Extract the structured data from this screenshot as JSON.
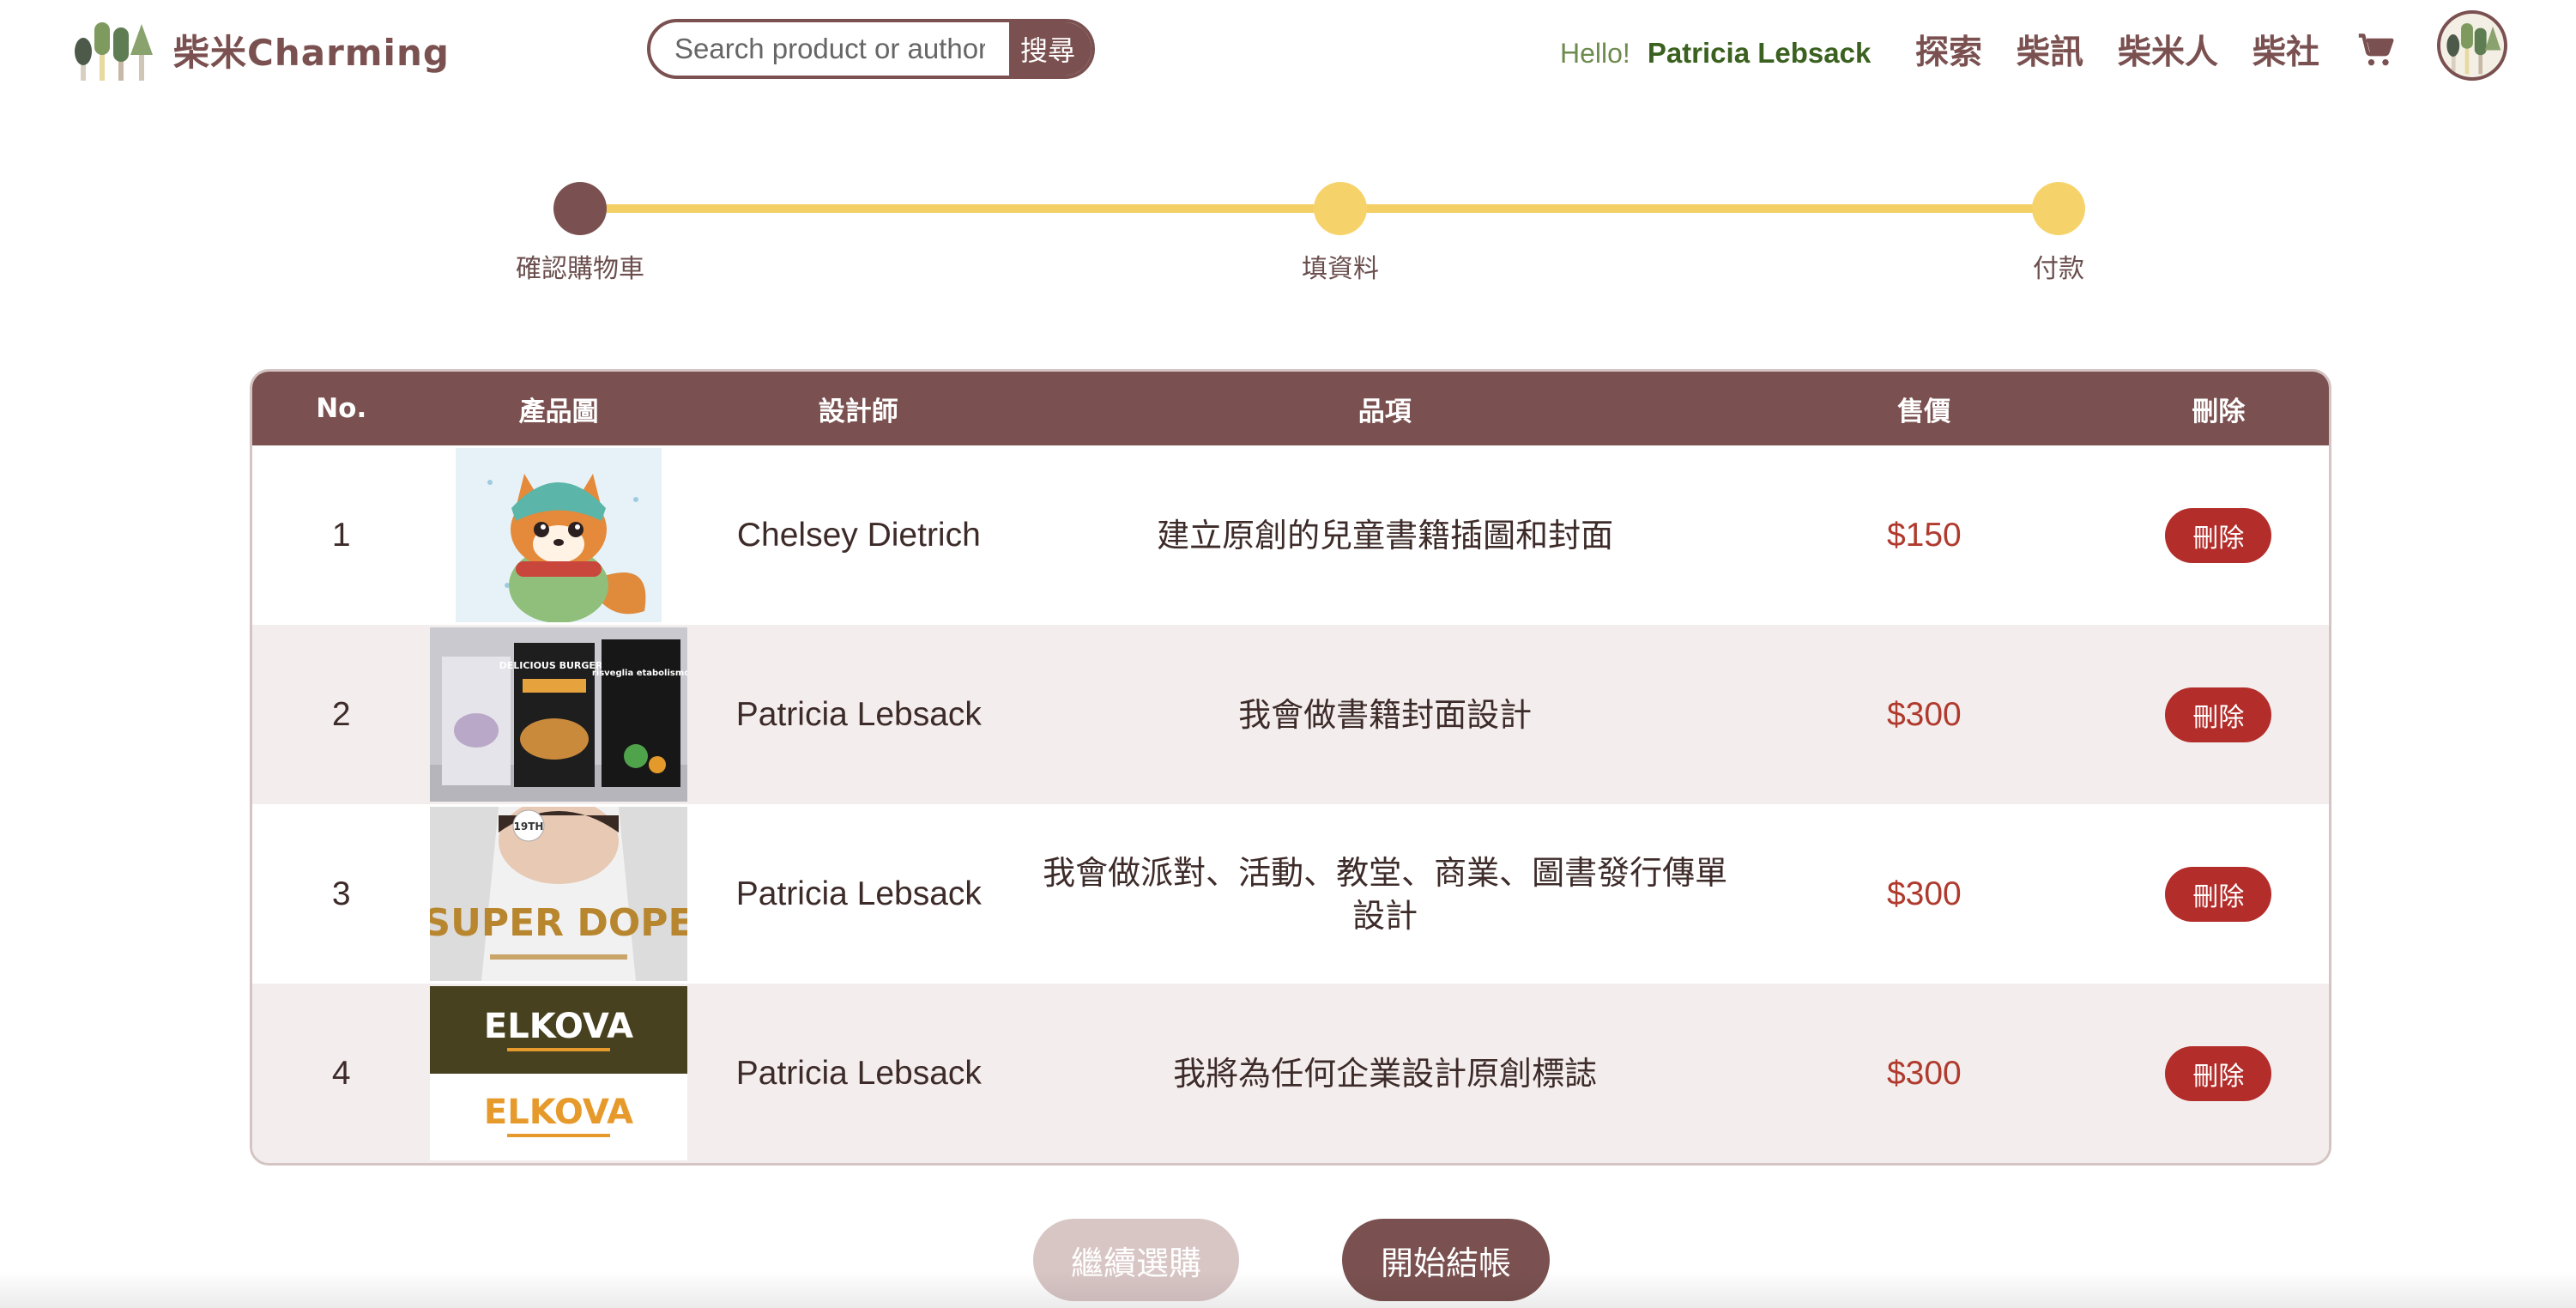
{
  "header": {
    "logo_text": "柴米Charming",
    "search_placeholder": "Search product or author",
    "search_button": "搜尋",
    "hello": "Hello!",
    "user_name": "Patricia Lebsack",
    "nav": [
      "探索",
      "柴訊",
      "柴米人",
      "柴社"
    ],
    "cart_icon": "cart-icon",
    "avatar_icon": "avatar-trees-icon"
  },
  "stepper": {
    "steps": [
      {
        "label": "確認購物車",
        "active": true
      },
      {
        "label": "填資料",
        "active": false
      },
      {
        "label": "付款",
        "active": false
      }
    ]
  },
  "table": {
    "headers": [
      "No.",
      "產品圖",
      "設計師",
      "品項",
      "售價",
      "刪除"
    ],
    "rows": [
      {
        "no": "1",
        "designer": "Chelsey Dietrich",
        "item": "建立原創的兒童書籍插圖和封面",
        "price": "$150",
        "delete": "刪除",
        "thumb": "fox-illustration"
      },
      {
        "no": "2",
        "designer": "Patricia Lebsack",
        "item": "我會做書籍封面設計",
        "price": "$300",
        "delete": "刪除",
        "thumb": "book-covers"
      },
      {
        "no": "3",
        "designer": "Patricia Lebsack",
        "item": "我會做派對、活動、教堂、商業、圖書發行傳單設計",
        "price": "$300",
        "delete": "刪除",
        "thumb": "party-flyer"
      },
      {
        "no": "4",
        "designer": "Patricia Lebsack",
        "item": "我將為任何企業設計原創標誌",
        "price": "$300",
        "delete": "刪除",
        "thumb": "logo-design"
      }
    ]
  },
  "thumb_text": {
    "book1": "DELICIOUS BURGERS",
    "book2": "risveglia etabolismo",
    "flyer_top": "19TH",
    "flyer_main": "SUPER DOPE",
    "logo": "ELKOVA"
  },
  "actions": {
    "continue": "繼續選購",
    "checkout": "開始結帳"
  },
  "colors": {
    "brand": "#7a5150",
    "step_inactive": "#f6d36a",
    "price": "#b03a2e",
    "delete": "#b32d2a",
    "user_name": "#3b6120"
  }
}
